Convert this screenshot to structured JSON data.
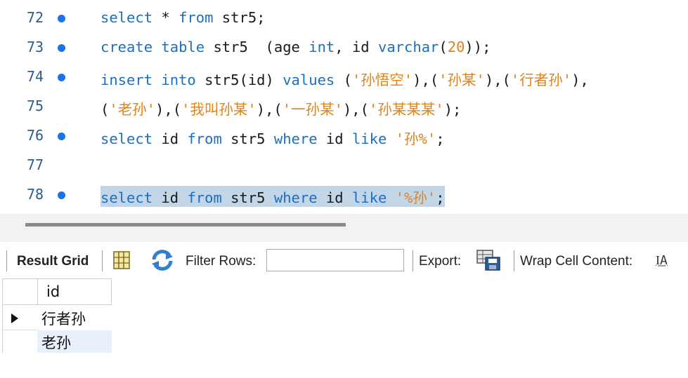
{
  "editor": {
    "lines": [
      {
        "no": "72",
        "dot": true,
        "tokens": [
          [
            "kw",
            "select"
          ],
          [
            "",
            " * "
          ],
          [
            "kw",
            "from"
          ],
          [
            "",
            " str5;"
          ]
        ]
      },
      {
        "no": "73",
        "dot": true,
        "tokens": [
          [
            "kw",
            "create"
          ],
          [
            "",
            " "
          ],
          [
            "kw",
            "table"
          ],
          [
            "",
            " str5  (age "
          ],
          [
            "kw",
            "int"
          ],
          [
            "",
            ", id "
          ],
          [
            "kw",
            "varchar"
          ],
          [
            "",
            "("
          ],
          [
            "num",
            "20"
          ],
          [
            "",
            "));"
          ]
        ]
      },
      {
        "no": "74",
        "dot": true,
        "tokens": [
          [
            "kw",
            "insert"
          ],
          [
            "",
            " "
          ],
          [
            "kw",
            "into"
          ],
          [
            "",
            " str5(id) "
          ],
          [
            "kw",
            "values"
          ],
          [
            "",
            " ("
          ],
          [
            "str",
            "'孙悟空'"
          ],
          [
            "",
            "),("
          ],
          [
            "str",
            "'孙某'"
          ],
          [
            "",
            "),("
          ],
          [
            "str",
            "'行者孙'"
          ],
          [
            "",
            "),"
          ]
        ]
      },
      {
        "no": "75",
        "dot": false,
        "tokens": [
          [
            "",
            "("
          ],
          [
            "str",
            "'老孙'"
          ],
          [
            "",
            "),("
          ],
          [
            "str",
            "'我叫孙某'"
          ],
          [
            "",
            "),("
          ],
          [
            "str",
            "'一孙某'"
          ],
          [
            "",
            "),("
          ],
          [
            "str",
            "'孙某某某'"
          ],
          [
            "",
            ");"
          ]
        ]
      },
      {
        "no": "76",
        "dot": true,
        "tokens": [
          [
            "kw",
            "select"
          ],
          [
            "",
            " id "
          ],
          [
            "kw",
            "from"
          ],
          [
            "",
            " str5 "
          ],
          [
            "kw",
            "where"
          ],
          [
            "",
            " id "
          ],
          [
            "kw",
            "like"
          ],
          [
            "",
            " "
          ],
          [
            "str",
            "'孙%'"
          ],
          [
            "",
            ";"
          ]
        ]
      },
      {
        "no": "77",
        "dot": false,
        "tokens": []
      },
      {
        "no": "78",
        "dot": true,
        "highlight": true,
        "tokens": [
          [
            "kw",
            "select"
          ],
          [
            "",
            " id "
          ],
          [
            "kw",
            "from"
          ],
          [
            "",
            " str5 "
          ],
          [
            "kw",
            "where"
          ],
          [
            "",
            " id "
          ],
          [
            "kw",
            "like"
          ],
          [
            "",
            " "
          ],
          [
            "str",
            "'%孙'"
          ],
          [
            "",
            ";"
          ]
        ]
      }
    ]
  },
  "toolbar": {
    "result_grid": "Result Grid",
    "filter_rows": "Filter Rows:",
    "filter_value": "",
    "export": "Export:",
    "wrap": "Wrap Cell Content:",
    "wrap_icon_glyph": "I͟A"
  },
  "grid": {
    "header": "id",
    "rows": [
      "行者孙",
      "老孙"
    ]
  },
  "colors": {
    "keyword": "#1b6fc2",
    "string": "#e0841a",
    "highlight": "#c3d6e8",
    "line_number": "#2d5c8a",
    "breakpoint": "#1a73e8"
  }
}
